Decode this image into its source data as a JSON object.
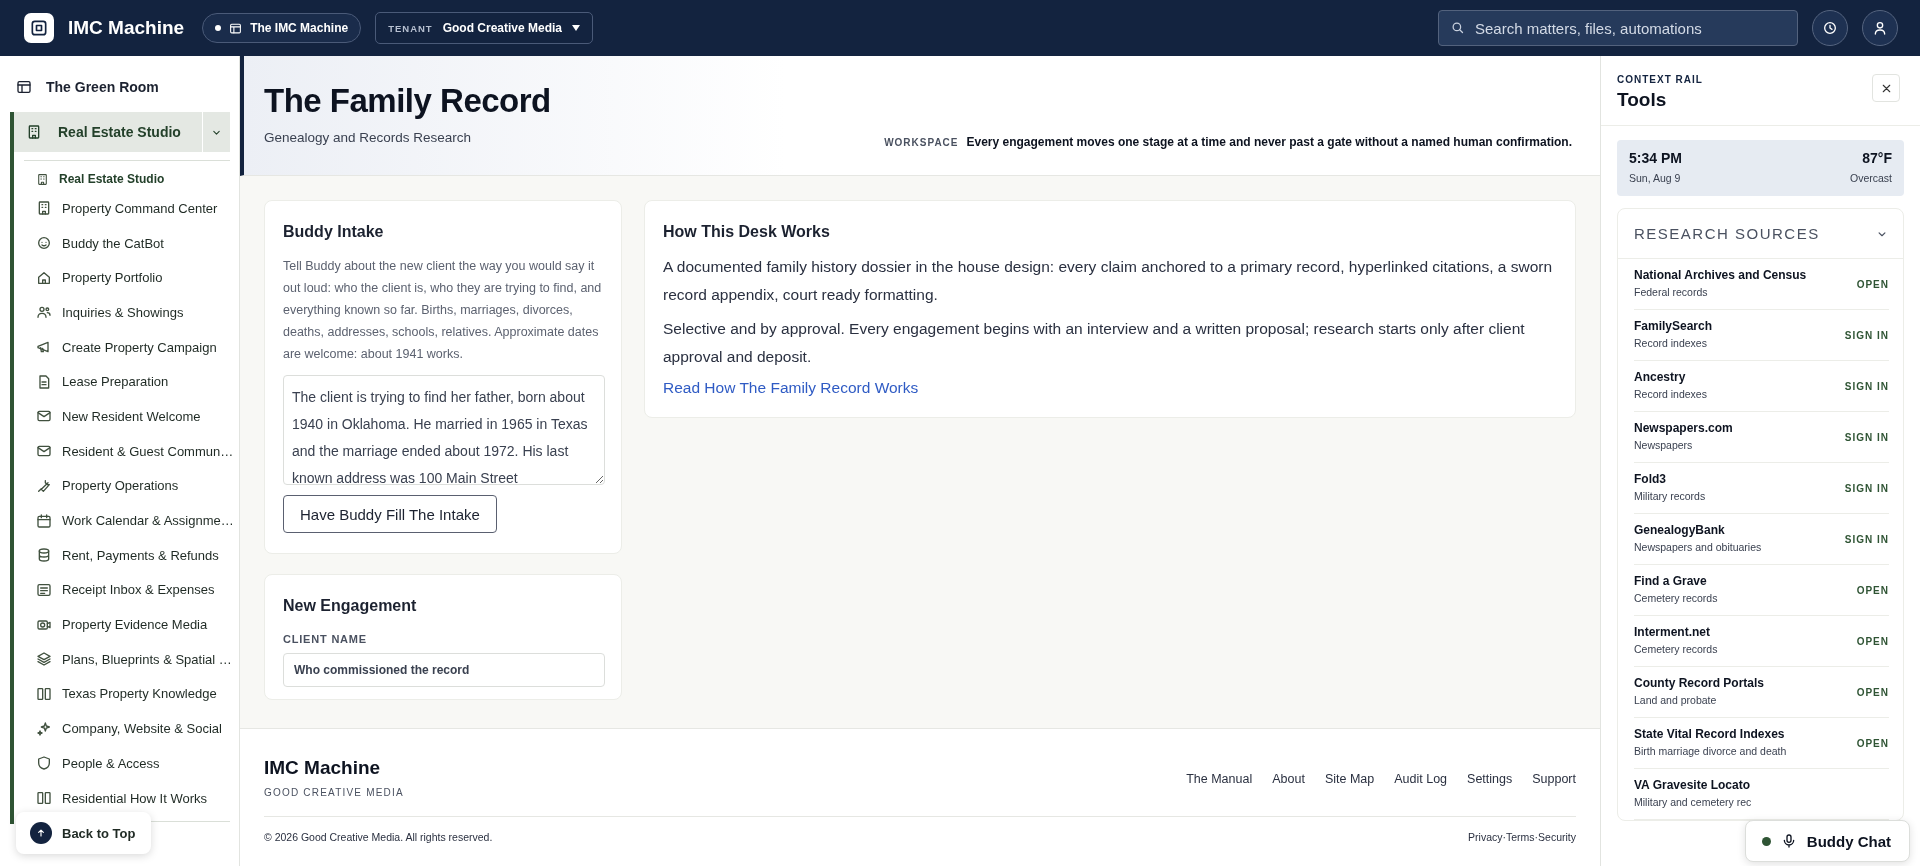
{
  "topbar": {
    "brand": "IMC Machine",
    "workspace_pill": "The IMC Machine",
    "tenant_label": "TENANT",
    "tenant_value": "Good Creative Media",
    "search": {
      "placeholder": "Search matters, files, automations"
    }
  },
  "sidebar": {
    "top_item": "The Green Room",
    "group": {
      "label": "Real Estate Studio",
      "expanded": true,
      "items": [
        {
          "label": "Real Estate Studio",
          "selected": true
        },
        {
          "label": "Property Command Center",
          "selected": false
        },
        {
          "label": "Buddy the CatBot",
          "selected": false
        },
        {
          "label": "Property Portfolio",
          "selected": false
        },
        {
          "label": "Inquiries & Showings",
          "selected": false
        },
        {
          "label": "Create Property Campaign",
          "selected": false
        },
        {
          "label": "Lease Preparation",
          "selected": false
        },
        {
          "label": "New Resident Welcome",
          "selected": false
        },
        {
          "label": "Resident & Guest Commun…",
          "selected": false
        },
        {
          "label": "Property Operations",
          "selected": false
        },
        {
          "label": "Work Calendar & Assignme…",
          "selected": false
        },
        {
          "label": "Rent, Payments & Refunds",
          "selected": false
        },
        {
          "label": "Receipt Inbox & Expenses",
          "selected": false
        },
        {
          "label": "Property Evidence Media",
          "selected": false
        },
        {
          "label": "Plans, Blueprints & Spatial …",
          "selected": false
        },
        {
          "label": "Texas Property Knowledge",
          "selected": false
        },
        {
          "label": "Company, Website & Social",
          "selected": false
        },
        {
          "label": "People & Access",
          "selected": false
        },
        {
          "label": "Residential How It Works",
          "selected": false
        }
      ]
    },
    "back_to_top": "Back to Top"
  },
  "header": {
    "title": "The Family Record",
    "subtitle": "Genealogy and Records Research",
    "workspace_label": "WORKSPACE",
    "workspace_text": "Every engagement moves one stage at a time and never past a gate without a named human confirmation."
  },
  "intake": {
    "title": "Buddy Intake",
    "description": "Tell Buddy about the new client the way you would say it out loud: who the client is, who they are trying to find, and everything known so far. Births, marriages, divorces, deaths, addresses, schools, relatives. Approximate dates are welcome: about 1941 works.",
    "value": "The client is trying to find her father, born about 1940 in Oklahoma. He married in 1965 in Texas and the marriage ended about 1972. His last known address was 100 Main Street",
    "button": "Have Buddy Fill The Intake"
  },
  "desk": {
    "title": "How This Desk Works",
    "paragraphs": [
      "A documented family history dossier in the house design: every claim anchored to a primary record, hyperlinked citations, a sworn record appendix, court ready formatting.",
      "Selective and by approval. Every engagement begins with an interview and a written proposal; research starts only after client approval and deposit."
    ],
    "link": "Read How The Family Record Works"
  },
  "engagement": {
    "title": "New Engagement",
    "field_label": "CLIENT NAME",
    "placeholder": "Who commissioned the record"
  },
  "footer": {
    "brand": "IMC Machine",
    "company": "GOOD CREATIVE MEDIA",
    "links": [
      "The Manual",
      "About",
      "Site Map",
      "Audit Log",
      "Settings",
      "Support"
    ],
    "copyright": "© 2026 Good Creative Media. All rights reserved.",
    "legal": "Privacy·Terms·Security"
  },
  "rail": {
    "eyebrow": "CONTEXT RAIL",
    "title": "Tools",
    "weather": {
      "time": "5:34 PM",
      "date": "Sun, Aug 9",
      "temperature": "87°F",
      "condition": "Overcast"
    },
    "sources": {
      "title": "RESEARCH SOURCES",
      "expanded": true,
      "items": [
        {
          "name": "National Archives and Census",
          "description": "Federal records",
          "action": "OPEN"
        },
        {
          "name": "FamilySearch",
          "description": "Record indexes",
          "action": "SIGN IN"
        },
        {
          "name": "Ancestry",
          "description": "Record indexes",
          "action": "SIGN IN"
        },
        {
          "name": "Newspapers.com",
          "description": "Newspapers",
          "action": "SIGN IN"
        },
        {
          "name": "Fold3",
          "description": "Military records",
          "action": "SIGN IN"
        },
        {
          "name": "GenealogyBank",
          "description": "Newspapers and obituaries",
          "action": "SIGN IN"
        },
        {
          "name": "Find a Grave",
          "description": "Cemetery records",
          "action": "OPEN"
        },
        {
          "name": "Interment.net",
          "description": "Cemetery records",
          "action": "OPEN"
        },
        {
          "name": "County Record Portals",
          "description": "Land and probate",
          "action": "OPEN"
        },
        {
          "name": "State Vital Record Indexes",
          "description": "Birth marriage divorce and death",
          "action": "OPEN"
        },
        {
          "name": "VA Gravesite Locato",
          "description": "Military and cemetery rec"
        }
      ]
    }
  },
  "buddy_chat": {
    "label": "Buddy Chat"
  }
}
